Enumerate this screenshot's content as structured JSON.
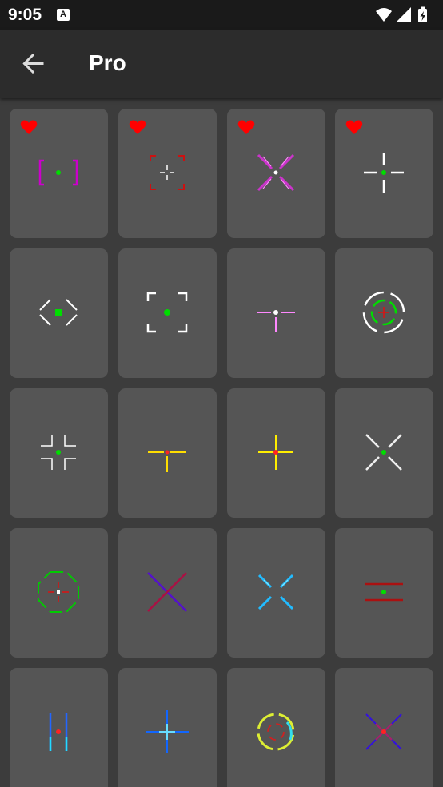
{
  "status_bar": {
    "time": "9:05",
    "notification_icon": "A",
    "icons": [
      "wifi-icon",
      "cell-signal-icon",
      "battery-charging-icon"
    ]
  },
  "app_bar": {
    "back_icon": "arrow-left-icon",
    "title": "Pro"
  },
  "favorite_icon": "heart-icon",
  "colors": {
    "background": "#3c3c3c",
    "app_bar": "#2c2c2c",
    "card": "#555555",
    "favorite": "#ff0000"
  },
  "crosshairs": [
    {
      "id": 1,
      "favorite": true
    },
    {
      "id": 2,
      "favorite": true
    },
    {
      "id": 3,
      "favorite": true
    },
    {
      "id": 4,
      "favorite": true
    },
    {
      "id": 5,
      "favorite": false
    },
    {
      "id": 6,
      "favorite": false
    },
    {
      "id": 7,
      "favorite": false
    },
    {
      "id": 8,
      "favorite": false
    },
    {
      "id": 9,
      "favorite": false
    },
    {
      "id": 10,
      "favorite": false
    },
    {
      "id": 11,
      "favorite": false
    },
    {
      "id": 12,
      "favorite": false
    },
    {
      "id": 13,
      "favorite": false
    },
    {
      "id": 14,
      "favorite": false
    },
    {
      "id": 15,
      "favorite": false
    },
    {
      "id": 16,
      "favorite": false
    },
    {
      "id": 17,
      "favorite": false
    },
    {
      "id": 18,
      "favorite": false
    },
    {
      "id": 19,
      "favorite": false
    },
    {
      "id": 20,
      "favorite": false
    }
  ]
}
